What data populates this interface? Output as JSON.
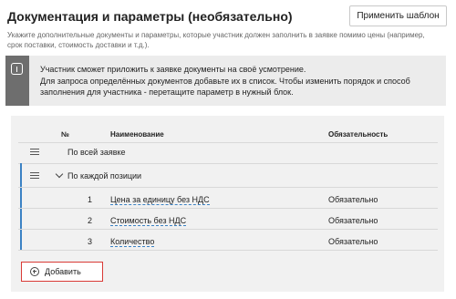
{
  "header": {
    "title": "Документация и параметры (необязательно)",
    "apply_template_label": "Применить шаблон",
    "subtitle": "Укажите дополнительные документы и параметры, которые участник должен заполнить в заявке помимо цены (например, срок поставки, стоимость доставки и т.д.)."
  },
  "notice": {
    "icon": "info-icon",
    "lines": [
      "Участник сможет приложить к заявке документы на своё усмотрение.",
      "Для запроса определённых документов добавьте их в список. Чтобы изменить порядок и способ",
      "заполнения для участника - перетащите параметр в нужный блок."
    ]
  },
  "table": {
    "headers": {
      "num": "№",
      "name": "Наименование",
      "required": "Обязательность"
    },
    "groups": [
      {
        "label": "По всей заявке"
      },
      {
        "label": "По каждой позиции"
      }
    ],
    "items": [
      {
        "num": "1",
        "name": "Цена за единицу без НДС",
        "required": "Обязательно"
      },
      {
        "num": "2",
        "name": "Стоимость без НДС",
        "required": "Обязательно"
      },
      {
        "num": "3",
        "name": "Количество",
        "required": "Обязательно"
      }
    ]
  },
  "add_button": {
    "label": "Добавить",
    "icon": "plus-circle-icon"
  },
  "colors": {
    "accent_blue": "#3b82c4",
    "highlight_red": "#d93a36",
    "notice_strip": "#6e6e6e"
  }
}
